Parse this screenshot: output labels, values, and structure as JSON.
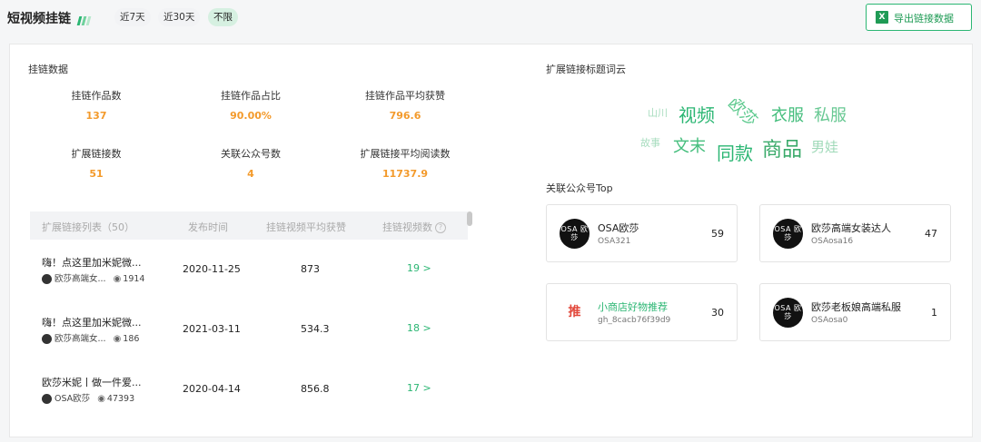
{
  "header": {
    "title": "短视频挂链",
    "ranges": [
      "近7天",
      "近30天",
      "不限"
    ],
    "active_range": "不限",
    "export_label": "导出链接数据"
  },
  "stats_section": {
    "title": "挂链数据",
    "items": [
      {
        "label": "挂链作品数",
        "value": "137"
      },
      {
        "label": "挂链作品占比",
        "value": "90.00%"
      },
      {
        "label": "挂链作品平均获赞",
        "value": "796.6"
      },
      {
        "label": "扩展链接数",
        "value": "51"
      },
      {
        "label": "关联公众号数",
        "value": "4"
      },
      {
        "label": "扩展链接平均阅读数",
        "value": "11737.9"
      }
    ]
  },
  "table": {
    "columns": [
      "扩展链接列表（50）",
      "发布时间",
      "挂链视频平均获赞",
      "挂链视频数"
    ],
    "rows": [
      {
        "title": "嗨！点这里加米妮微...",
        "author": "欧莎高端女...",
        "views": "1914",
        "date": "2020-11-25",
        "avg_likes": "873",
        "video_count": "19"
      },
      {
        "title": "嗨！点这里加米妮微...",
        "author": "欧莎高端女...",
        "views": "186",
        "date": "2021-03-11",
        "avg_likes": "534.3",
        "video_count": "18"
      },
      {
        "title": "欧莎米妮丨做一件爱...",
        "author": "OSA欧莎",
        "views": "47393",
        "date": "2020-04-14",
        "avg_likes": "856.8",
        "video_count": "17"
      }
    ]
  },
  "word_cloud": {
    "title": "扩展链接标题词云",
    "words": [
      {
        "text": "山川",
        "color": "#a8ddbf"
      },
      {
        "text": "视频",
        "color": "#2bb673"
      },
      {
        "text": "欧莎",
        "color": "#5cc98d"
      },
      {
        "text": "衣服",
        "color": "#45be7d"
      },
      {
        "text": "私服",
        "color": "#67c892"
      },
      {
        "text": "故事",
        "color": "#a8ddbf"
      },
      {
        "text": "文末",
        "color": "#45be7d"
      },
      {
        "text": "同款",
        "color": "#2bb673"
      },
      {
        "text": "商品",
        "color": "#3aaa6a"
      },
      {
        "text": "男娃",
        "color": "#9fd9b8"
      }
    ]
  },
  "accounts": {
    "title": "关联公众号Top",
    "items": [
      {
        "name": "OSA欧莎",
        "id": "OSA321",
        "count": "59",
        "avatar": "OSA 欧莎"
      },
      {
        "name": "欧莎高端女装达人",
        "id": "OSAosa16",
        "count": "47",
        "avatar": "OSA 欧莎"
      },
      {
        "name": "小商店好物推荐",
        "id": "gh_8cacb76f39d9",
        "count": "30",
        "avatar": "推"
      },
      {
        "name": "欧莎老板娘高端私服",
        "id": "OSAosa0",
        "count": "1",
        "avatar": "OSA 欧莎"
      }
    ]
  },
  "colors": {
    "accent": "#2bb673",
    "value_orange": "#f39a2b"
  }
}
